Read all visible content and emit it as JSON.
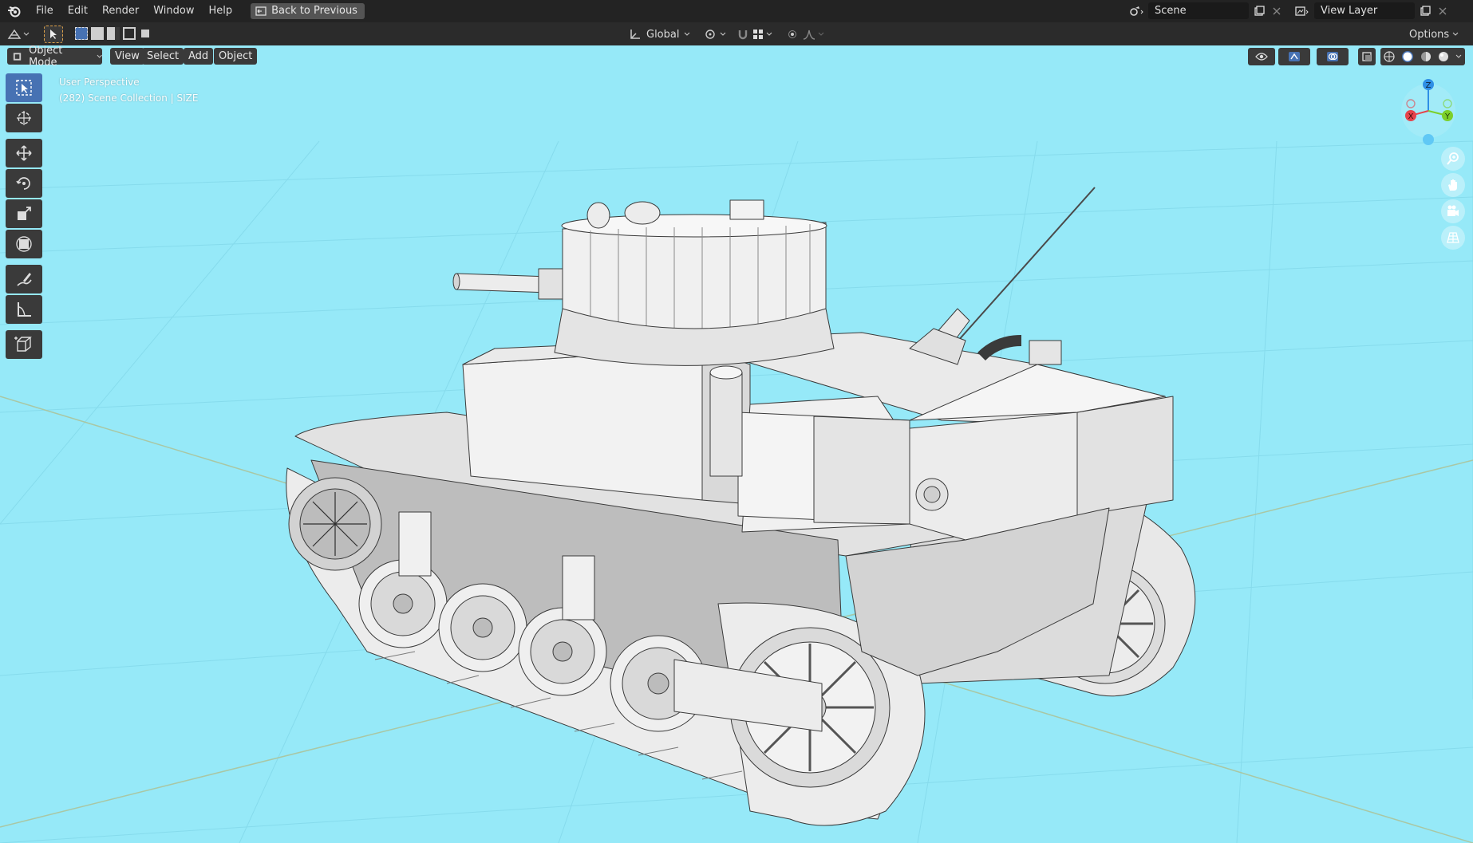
{
  "menubar": {
    "items": [
      "File",
      "Edit",
      "Render",
      "Window",
      "Help"
    ],
    "back_label": "Back to Previous",
    "scene_label": "Scene",
    "viewlayer_label": "View Layer"
  },
  "toolheader": {
    "orientation_label": "Global",
    "options_label": "Options"
  },
  "viewport_header": {
    "mode_label": "Object Mode",
    "menus": [
      "View",
      "Select",
      "Add",
      "Object"
    ]
  },
  "viewport": {
    "perspective_label": "User Perspective",
    "collection_label": "(282) Scene Collection | SIZE",
    "background_color": "#96e9f8",
    "gizmo_axes": {
      "x": "X",
      "y": "Y",
      "z": "Z"
    }
  },
  "colors": {
    "accent": "#4772b3",
    "x_axis": "#e5434a",
    "y_axis": "#7ccf2a",
    "z_axis": "#2e8fe6"
  },
  "tools": [
    "select-box-icon",
    "cursor-icon",
    "move-icon",
    "rotate-icon",
    "scale-icon",
    "transform-icon",
    "annotate-icon",
    "measure-icon",
    "add-cube-icon"
  ]
}
